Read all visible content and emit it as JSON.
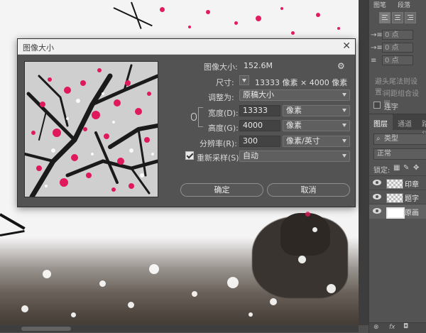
{
  "right_panel": {
    "tab1": "图层",
    "tab2": "通道",
    "tab3": "路径",
    "panel_tabs_top": [
      "图笔",
      "段落"
    ],
    "spin_value": "0 点",
    "hyphen_label": "避头尾法则设置:",
    "compose_label": "间距组合设置:",
    "hyphenate_label": "连字",
    "filter_label": "类型",
    "blend_mode": "正常",
    "lock_label": "锁定:",
    "layers": [
      {
        "name": "印章"
      },
      {
        "name": "题字"
      },
      {
        "name": "原画"
      }
    ],
    "footer_fx": "fx"
  },
  "dialog": {
    "title": "图像大小",
    "image_size_label": "图像大小:",
    "image_size_value": "152.6M",
    "dimensions_label": "尺寸:",
    "dimensions_value": "13333 像素 × 4000 像素",
    "fit_to_label": "调整为:",
    "fit_to_value": "原稿大小",
    "width_label": "宽度(D):",
    "width_value": "13333",
    "width_unit": "像素",
    "height_label": "高度(G):",
    "height_value": "4000",
    "height_unit": "像素",
    "resolution_label": "分辨率(R):",
    "resolution_value": "300",
    "resolution_unit": "像素/英寸",
    "resample_label": "重新采样(S):",
    "resample_value": "自动",
    "ok_label": "确定",
    "cancel_label": "取消"
  }
}
